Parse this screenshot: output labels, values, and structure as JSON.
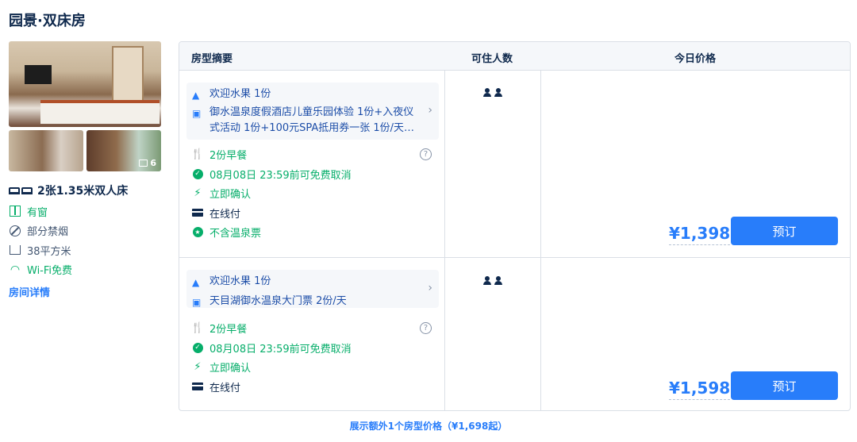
{
  "room_title": "园景·双床房",
  "photos": {
    "count": "6"
  },
  "room_info": {
    "bed": "2张1.35米双人床",
    "features": [
      {
        "icon": "window-icon",
        "label": "有窗",
        "color": "#06ae6a"
      },
      {
        "icon": "no-smoking-icon",
        "label": "部分禁烟",
        "color": "#455873"
      },
      {
        "icon": "area-icon",
        "label": "38平方米",
        "color": "#455873"
      },
      {
        "icon": "wifi-icon",
        "label": "Wi-Fi免费",
        "color": "#06ae6a"
      }
    ],
    "detail_link": "房间详情"
  },
  "table": {
    "headers": {
      "summary": "房型摘要",
      "occupancy": "可住人数",
      "price": "今日价格"
    }
  },
  "rates": [
    {
      "gifts": [
        {
          "icon": "cloche-icon",
          "text": "欢迎水果 1份"
        },
        {
          "icon": "gift-icon",
          "text": "御水温泉度假酒店儿童乐园体验 1份+入夜仪式活动 1份+100元SPA抵用券一张 1份/天+…"
        }
      ],
      "conditions": [
        {
          "icon": "fork-knife-icon",
          "text": "2份早餐"
        },
        {
          "icon": "check-circle-icon",
          "text": "08月08日 23:59前可免费取消"
        },
        {
          "icon": "lightning-icon",
          "text": "立即确认"
        },
        {
          "icon": "card-icon",
          "text": "在线付"
        },
        {
          "icon": "star-circle-icon",
          "text": "不含温泉票"
        }
      ],
      "guests": 2,
      "price": "¥1,398",
      "book_label": "预订"
    },
    {
      "gifts": [
        {
          "icon": "cloche-icon",
          "text": "欢迎水果 1份"
        },
        {
          "icon": "gift-icon",
          "text": "天目湖御水温泉大门票 2份/天"
        }
      ],
      "conditions": [
        {
          "icon": "fork-knife-icon",
          "text": "2份早餐"
        },
        {
          "icon": "check-circle-icon",
          "text": "08月08日 23:59前可免费取消"
        },
        {
          "icon": "lightning-icon",
          "text": "立即确认"
        },
        {
          "icon": "card-icon",
          "text": "在线付"
        }
      ],
      "guests": 2,
      "price": "¥1,598",
      "book_label": "预订"
    }
  ],
  "more_link": "展示额外1个房型价格（¥1,698起）",
  "colors": {
    "accent": "#287dfa",
    "green": "#06ae6a",
    "text": "#0f294d"
  }
}
